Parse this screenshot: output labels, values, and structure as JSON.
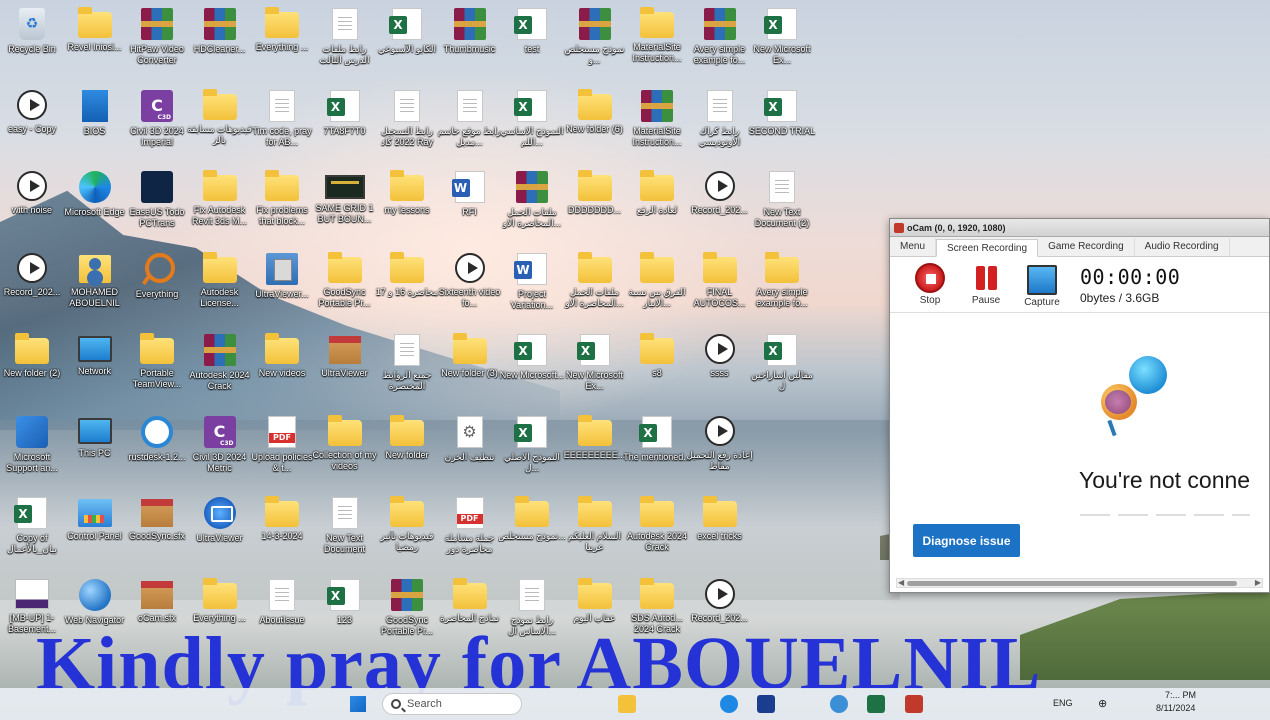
{
  "desktop": {
    "icons": [
      {
        "label": "Recycle Bin",
        "icon": "recycle-bin-icon"
      },
      {
        "label": "Revel Iniosi...",
        "icon": "folder-icon"
      },
      {
        "label": "HitPaw Video Converter",
        "icon": "rar-archive-icon"
      },
      {
        "label": "HDCleaner...",
        "icon": "rar-archive-icon"
      },
      {
        "label": "Everything ...",
        "icon": "folder-icon"
      },
      {
        "label": "رابط ملفات الدرس الثالث",
        "icon": "text-document-icon"
      },
      {
        "label": "الكابو الأسبوعي",
        "icon": "excel-file-icon"
      },
      {
        "label": "Thumbmusic",
        "icon": "rar-archive-icon"
      },
      {
        "label": "test",
        "icon": "excel-file-icon"
      },
      {
        "label": "نموذج مستخلص و...",
        "icon": "rar-archive-icon"
      },
      {
        "label": "MaterialSite Instruction...",
        "icon": "folder-icon"
      },
      {
        "label": "Avery simple example fo...",
        "icon": "rar-archive-icon"
      },
      {
        "label": "New Microsoft Ex...",
        "icon": "excel-file-icon"
      },
      {
        "label": "easy - Copy",
        "icon": "video-file-icon"
      },
      {
        "label": "BIOS",
        "icon": "bios-icon"
      },
      {
        "label": "Civil 3D 2024 Imperial",
        "icon": "civil3d-icon"
      },
      {
        "label": "فيديوهات مسابقة بالز",
        "icon": "folder-icon"
      },
      {
        "label": "Tim code, pray for AB...",
        "icon": "text-document-icon"
      },
      {
        "label": "7TA8F7T0",
        "icon": "excel-file-icon"
      },
      {
        "label": "رابط التسجيل 2022 كاد Ray",
        "icon": "text-document-icon"
      },
      {
        "label": "رابط موقع حاسم مدبل...",
        "icon": "text-document-icon"
      },
      {
        "label": "النموذج الاساسي اللم...",
        "icon": "excel-file-icon"
      },
      {
        "label": "New folder (6)",
        "icon": "folder-icon"
      },
      {
        "label": "MaterialSite Instruction...",
        "icon": "rar-archive-icon"
      },
      {
        "label": "رابط كراك الاوتوديسي",
        "icon": "text-document-icon"
      },
      {
        "label": "SECOND TRIAL",
        "icon": "excel-file-icon"
      },
      {
        "label": "with noise",
        "icon": "video-file-icon"
      },
      {
        "label": "Microsoft Edge",
        "icon": "edge-browser-icon"
      },
      {
        "label": "EaseUS Todo PCTrans",
        "icon": "easeus-icon"
      },
      {
        "label": "Fix Autodesk Revit 3ds M...",
        "icon": "folder-icon"
      },
      {
        "label": "Fix problems that block...",
        "icon": "folder-icon"
      },
      {
        "label": "SAME GRID 1 BUT BOUN...",
        "icon": "screenshot-icon"
      },
      {
        "label": "my lessons",
        "icon": "folder-icon"
      },
      {
        "label": "RFI",
        "icon": "word-file-icon"
      },
      {
        "label": "ملفات الحمل المحاضرة الاو...",
        "icon": "rar-archive-icon"
      },
      {
        "label": "DDDDDDD...",
        "icon": "folder-icon"
      },
      {
        "label": "لعادة الرفع",
        "icon": "folder-icon"
      },
      {
        "label": "Record_202...",
        "icon": "video-file-icon"
      },
      {
        "label": "New Text Document (2)",
        "icon": "text-document-icon"
      },
      {
        "label": "Record_202...",
        "icon": "video-file-icon"
      },
      {
        "label": "MOHAMED ABOUELNIL",
        "icon": "user-folder-icon"
      },
      {
        "label": "Everything",
        "icon": "everything-search-icon"
      },
      {
        "label": "Autodesk License...",
        "icon": "folder-icon"
      },
      {
        "label": "UltraViewer...",
        "icon": "installer-icon"
      },
      {
        "label": "GoodSync Portable Pr...",
        "icon": "folder-icon"
      },
      {
        "label": "محاضرة 16 و 17",
        "icon": "folder-icon"
      },
      {
        "label": "Sixteenth video fo...",
        "icon": "video-file-icon"
      },
      {
        "label": "Project Variation...",
        "icon": "word-file-icon"
      },
      {
        "label": "ملفات الحمل المحاضرة الاو...",
        "icon": "folder-icon"
      },
      {
        "label": "الفرق بين نسبة الانبار...",
        "icon": "folder-icon"
      },
      {
        "label": "FINAL AUTOCOS...",
        "icon": "folder-icon"
      },
      {
        "label": "Avery simple example fo...",
        "icon": "folder-icon"
      },
      {
        "label": "New folder (2)",
        "icon": "folder-icon"
      },
      {
        "label": "Network",
        "icon": "network-icon"
      },
      {
        "label": "Portable TeamView...",
        "icon": "folder-icon"
      },
      {
        "label": "Autodesk 2024 Crack",
        "icon": "rar-archive-icon"
      },
      {
        "label": "New videos",
        "icon": "folder-icon"
      },
      {
        "label": "UltraViewer",
        "icon": "box-icon"
      },
      {
        "label": "جميع الروابط المختصرة",
        "icon": "text-document-icon"
      },
      {
        "label": "New folder (3)",
        "icon": "folder-icon"
      },
      {
        "label": "New Microsoft...",
        "icon": "excel-file-icon"
      },
      {
        "label": "New Microsoft Ex...",
        "icon": "excel-file-icon"
      },
      {
        "label": "s8",
        "icon": "folder-icon"
      },
      {
        "label": "ssss",
        "icon": "video-file-icon"
      },
      {
        "label": "مقالين اساراخين ل",
        "icon": "excel-file-icon"
      },
      {
        "label": "Microsoft Support an...",
        "icon": "ms-support-icon"
      },
      {
        "label": "This PC",
        "icon": "this-pc-icon"
      },
      {
        "label": "rustdesk-1.2...",
        "icon": "rustdesk-icon"
      },
      {
        "label": "Civil 3D 2024 Metric",
        "icon": "civil3d-icon"
      },
      {
        "label": "Upload policies & t...",
        "icon": "pdf-file-icon"
      },
      {
        "label": "Collection of my videos",
        "icon": "folder-icon"
      },
      {
        "label": "New folder",
        "icon": "folder-icon"
      },
      {
        "label": "تنظيف الخزن",
        "icon": "settings-file-icon"
      },
      {
        "label": "النموذج الاصلي ل...",
        "icon": "excel-file-icon"
      },
      {
        "label": "EEEEEEEEE...",
        "icon": "folder-icon"
      },
      {
        "label": "The mentioned...",
        "icon": "excel-file-icon"
      },
      {
        "label": "إعادة رفع التحميل مقاط",
        "icon": "video-file-icon"
      },
      {
        "label": "Copy of بيان_بالأعمال",
        "icon": "excel-file-icon"
      },
      {
        "label": "Control Panel",
        "icon": "control-panel-icon"
      },
      {
        "label": "GoodSync.sfx",
        "icon": "box-icon"
      },
      {
        "label": "UltraViewer",
        "icon": "ultraviewer-icon"
      },
      {
        "label": "14-3-2024",
        "icon": "folder-icon"
      },
      {
        "label": "New Text Document",
        "icon": "text-document-icon"
      },
      {
        "label": "فيديوهات تأثير رمضيا",
        "icon": "folder-icon"
      },
      {
        "label": "جملة مشاملة محاضرة دور",
        "icon": "pdf-file-icon"
      },
      {
        "label": "نموذج مستخلص...",
        "icon": "folder-icon"
      },
      {
        "label": "السلام العليكم عربيا",
        "icon": "folder-icon"
      },
      {
        "label": "Autodesk 2024 Crack",
        "icon": "folder-icon"
      },
      {
        "label": "excel tricks",
        "icon": "folder-icon"
      },
      {
        "label": "[MB-UP] 1-Basement...",
        "icon": "image-file-icon"
      },
      {
        "label": "Web Navigator",
        "icon": "globe-icon"
      },
      {
        "label": "oCam.sfx",
        "icon": "box-icon"
      },
      {
        "label": "Everything ...",
        "icon": "folder-icon"
      },
      {
        "label": "AboutIssue",
        "icon": "text-document-icon"
      },
      {
        "label": "123",
        "icon": "excel-file-icon"
      },
      {
        "label": "GoodSync Portable Pr...",
        "icon": "rar-archive-icon"
      },
      {
        "label": "نماذج المحاضرة",
        "icon": "folder-icon"
      },
      {
        "label": "رابط نموذج الاساس ال...",
        "icon": "text-document-icon"
      },
      {
        "label": "عقاب اليوم",
        "icon": "folder-icon"
      },
      {
        "label": "SDS Autod... 2024 Crack",
        "icon": "folder-icon"
      },
      {
        "label": "Record_202...",
        "icon": "video-file-icon"
      }
    ]
  },
  "ocam": {
    "title": "oCam (0, 0, 1920, 1080)",
    "tabs": [
      "Menu",
      "Screen Recording",
      "Game Recording",
      "Audio Recording"
    ],
    "active_tab": "Screen Recording",
    "toolbar": {
      "stop_label": "Stop",
      "pause_label": "Pause",
      "capture_label": "Capture"
    },
    "timer": "00:00:00",
    "size": "0bytes / 3.6GB",
    "body": {
      "message": "You're not conne",
      "diagnose_label": "Diagnose issue"
    }
  },
  "banner": {
    "text": "Kindly pray for ABOUELNIL"
  },
  "taskbar": {
    "search_placeholder": "Search",
    "language": "ENG",
    "time": "7:... PM",
    "date": "8/11/2024"
  }
}
